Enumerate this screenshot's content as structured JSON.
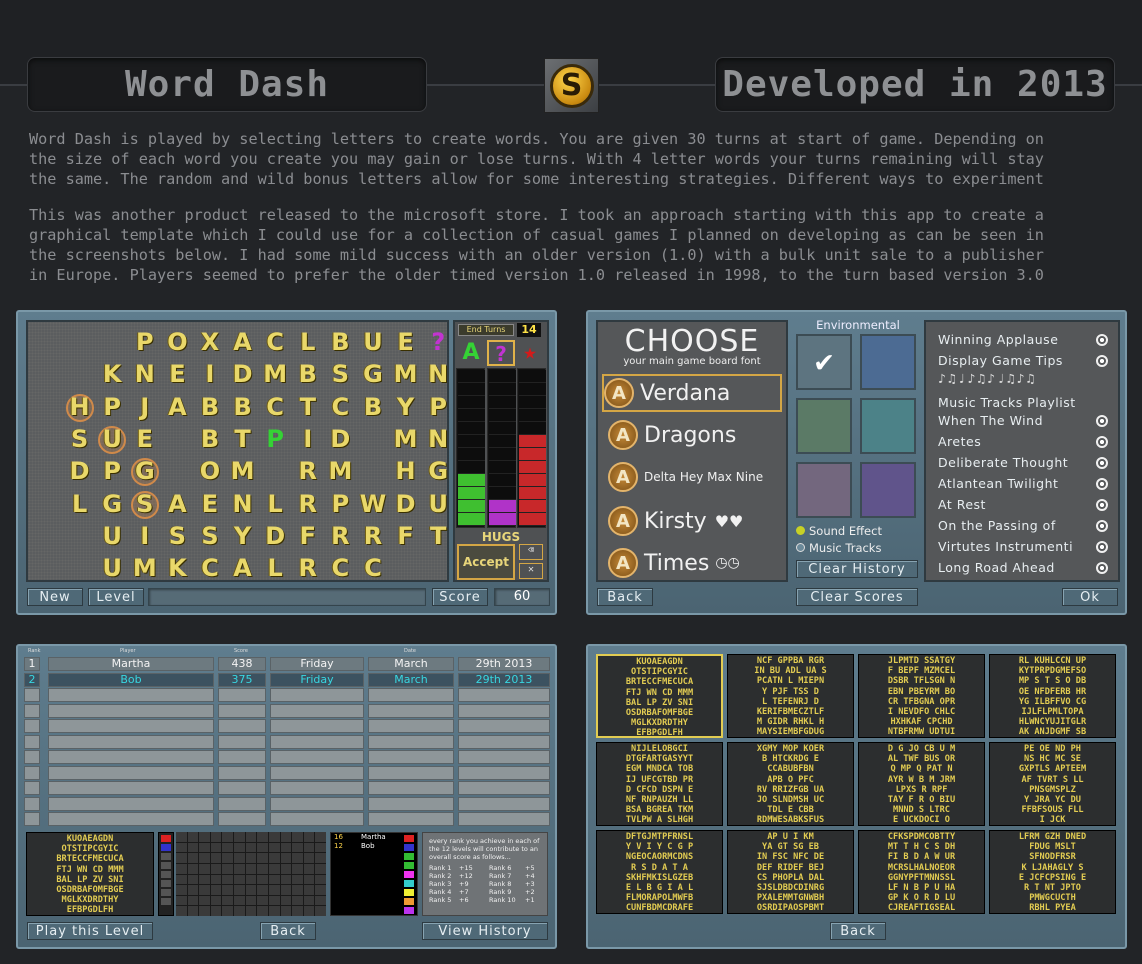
{
  "header": {
    "title": "Word Dash",
    "logo_letter": "S",
    "subtitle": "Developed in 2013"
  },
  "description": [
    "Word Dash is played by selecting letters to create words. You are given 30 turns at start of game. Depending on",
    "the size of each word you create you may gain or lose turns. With 4 letter words your turns remaining will stay",
    "the same. The random and wild bonus letters allow for some interesting strategies. Different ways to experiment",
    "This was another product released to the microsoft store. I took an approach starting with this app to create a",
    "graphical template which I could use for a collection of casual games I planned on developing as can be seen in",
    "the screenshots below. I had some mild success with an older version (1.0) with a bulk unit sale to a publisher",
    "in Europe. Players seemed to prefer the older timed version 1.0 released in 1998, to the turn based version 3.0"
  ],
  "game_board": {
    "rows": [
      "   POXACLBUE?",
      "  KNEIDMBSGMN",
      " HPJABBCTCBYPR",
      " SUE BTPID MNB",
      " DPG OM RM HGI",
      " LGSAENLRPWDUD",
      "  UISSYDFRRFT",
      "  UMKCALRCC"
    ],
    "end_turns_label": "End Turns",
    "end_turns_value": "14",
    "bonus_letter": "A",
    "wild_letter": "?",
    "star_letter": "A",
    "status_word": "HUGS",
    "accept_label": "Accept",
    "new_label": "New",
    "level_label": "Level",
    "score_label": "Score",
    "score_value": "60"
  },
  "choose": {
    "title": "CHOOSE",
    "subtitle": "your main game board font",
    "fonts": [
      "Verdana",
      "Dragons",
      "Delta Hey Max Nine",
      "Kirsty",
      "Times"
    ],
    "environmental_label": "Environmental",
    "sound_effect_label": "Sound Effect",
    "music_tracks_label": "Music Tracks",
    "clear_history_label": "Clear History",
    "options": [
      "Winning Applause",
      "Display Game Tips"
    ],
    "playlist_title": "Music Tracks Playlist",
    "tracks": [
      "When The Wind",
      "Aretes",
      "Deliberate Thought",
      "Atlantean Twilight",
      "At Rest",
      "On the Passing of",
      "Virtutes Instrumenti",
      "Long Road Ahead"
    ],
    "back_label": "Back",
    "clear_scores_label": "Clear Scores",
    "ok_label": "Ok"
  },
  "high_scores": {
    "headers": [
      "Rank",
      "Player",
      "Score",
      "Date"
    ],
    "rows": [
      [
        "1",
        "Martha",
        "438",
        "Friday",
        "March",
        "29th 2013"
      ],
      [
        "2",
        "Bob",
        "375",
        "Friday",
        "March",
        "29th 2013"
      ]
    ],
    "mini_grid": "KUOAEAGDN\nOTSTIPCGYIC\nBRTECCFMECUCA\nFTJ WN CD MMM\nBAL LP ZV SNI\nOSDRBAFOMFBGE\nMGLKXDRDTHY\nEFBPGDLFH",
    "legend": [
      [
        "16",
        "Martha"
      ],
      [
        "12",
        "Bob"
      ]
    ],
    "rank_note": "every rank you achieve in each of the 12 levels will contribute to an overall score as follows...",
    "ranks": [
      [
        "Rank 1",
        "+15",
        "Rank 6",
        "+5"
      ],
      [
        "Rank 2",
        "+12",
        "Rank 7",
        "+4"
      ],
      [
        "Rank 3",
        "+9",
        "Rank 8",
        "+3"
      ],
      [
        "Rank 4",
        "+7",
        "Rank 9",
        "+2"
      ],
      [
        "Rank 5",
        "+6",
        "Rank 10",
        "+1"
      ]
    ],
    "play_label": "Play this Level",
    "back_label": "Back",
    "history_label": "View History"
  },
  "levels": {
    "grids": [
      "KUOAEAGDN\nOTSTIPCGYIC\nBRTECCFMECUCA\nFTJ WN CD MMM\nBAL LP ZV SNI\nOSDRBAFOMFBGE\nMGLKXDRDTHY\nEFBPGDLFH",
      "NCF GPPBA RGR\nIN BU ADL UA S\nPCATN L MIEPN\nY PJF TSS D\nL TEFENRJ D\nKERIFBMECZTLF\nM GIDR RHKL H\nMAYSIEMBFGDUG",
      "JLPMTD SSATGY\nF BEPF MZMCEL\nDSBR TFLSGN N\nEBN PBEYRM BO\nCR TFBGNA OPR\nI NEVDFO CHLC\nHXHKAF CPCHD\nNTBFRMW UDTUI",
      "RL KUHLCCN UP\nKYTPRPDGMEFSO\nMP S T S O DB\nOE NFDFERB HR\nYG ILBFFVO CG\nIJLFLPMLTOPA\nHLWNCYUJITGLR\nAK ANJDGMF SB",
      "NIJLELOBGCI\nDTGFARTGASYYT\nEGM MNDCA TOB\nIJ UFCGTBD PR\nD CFCD DSPN E\nNF RNPAUZH LL\nBSA BGREA TKM\nTVLPW A SLHGH",
      "XGMY MOP KOER\nB HTCKRDG E\nCCABUBFBN\nAPB O PFC\nRV RRIZFGB UA\nJO SLNDMSH UC\nTDL E CBB\nRDMWESABKSFUS",
      "D G JO CB U M\nAL TWF BUS OR\nQ MP Q PAT N\nAYR W B M JRM\nLPXS R RPF\nTAY F R O BIU\nMNND S LTRC\nE UCKDOCI O",
      "PE OE ND PH\nNS HC MC SE\nGXPTLS APTEEM\nAF TVRT S LL\nPNSGMSPLZ\nY JRA YC DU\nFFBFSOUS FLL\nI JCK",
      "DFTGJMTPFRNSL\nY V I Y C G P\nNGEOCAORMCDNS\nR S D A T A\nSKHFMKISLGZEB\nE L B G I A L\nFLMORAPOLMWFB\nCUNFBDMCDRAFE",
      "AP U I KM\nYA GT SG EB\nIN FSC NFC DE\nDEF RIDEF BEJ\nCS PHOPLA DAL\nSJSLDBDCDINRG\nPXALEMMTGNWBH\nOSRDIPAOSPBMT",
      "CFKSPDMCOBTTY\nMT T H C S DH\nFI B D A W UR\nMCRSLHALNOEOR\nGGNYPFTMNNSSL\nLF N B P U HA\nGP K O R D LU\nCJREAFTIGSEAL",
      "LFRM GZH DNED\nFDUG MSLT\nSFNODFRSR\nK LJAHAGLY S\nE JCFCPSING E\nR T NT JPTO\nPMWGCUCTH\nRBHL PYEA"
    ],
    "back_label": "Back"
  }
}
